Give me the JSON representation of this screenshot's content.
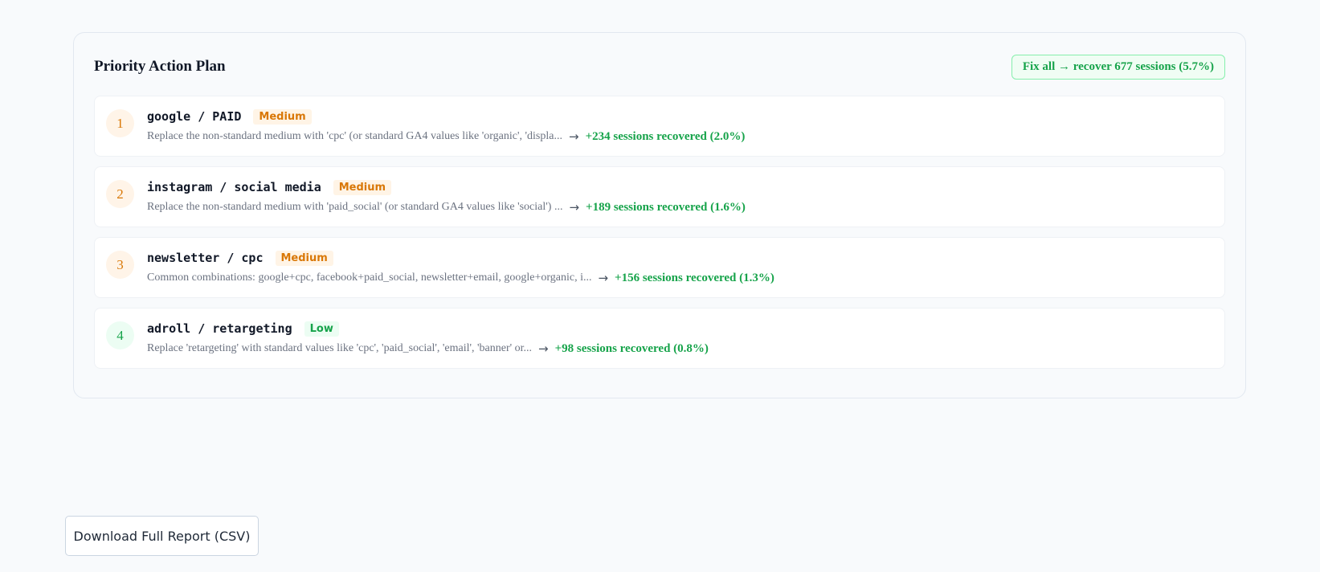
{
  "panel": {
    "title": "Priority Action Plan",
    "fix_all": "Fix all → recover 677 sessions (5.7%)"
  },
  "items": [
    {
      "rank": "1",
      "source": "google / PAID",
      "severity": "Medium",
      "description": "Replace the non-standard medium with 'cpc' (or standard GA4 values like 'organic', 'displa...",
      "arrow": "→",
      "recovered": "+234 sessions recovered (2.0%)"
    },
    {
      "rank": "2",
      "source": "instagram / social media",
      "severity": "Medium",
      "description": "Replace the non-standard medium with 'paid_social' (or standard GA4 values like 'social') ...",
      "arrow": "→",
      "recovered": "+189 sessions recovered (1.6%)"
    },
    {
      "rank": "3",
      "source": "newsletter / cpc",
      "severity": "Medium",
      "description": "Common combinations: google+cpc, facebook+paid_social, newsletter+email, google+organic, i...",
      "arrow": "→",
      "recovered": "+156 sessions recovered (1.3%)"
    },
    {
      "rank": "4",
      "source": "adroll / retargeting",
      "severity": "Low",
      "description": "Replace 'retargeting' with standard values like 'cpc', 'paid_social', 'email', 'banner' or...",
      "arrow": "→",
      "recovered": "+98 sessions recovered (0.8%)"
    }
  ],
  "download": {
    "label": "Download Full Report (CSV)"
  },
  "colors": {
    "medium": "#d97706",
    "low": "#16a34a",
    "recovered": "#16a34a"
  }
}
